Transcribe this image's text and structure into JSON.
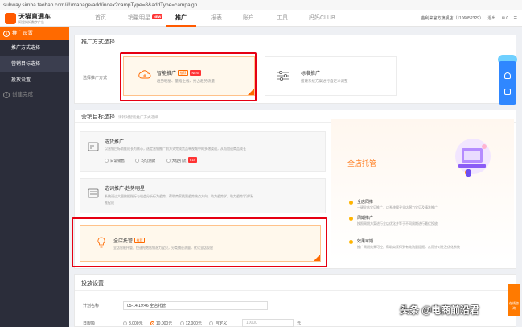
{
  "browser": {
    "url": "subway.simba.taobao.com/#!/manage/add/index?campType=8&addType=campaign"
  },
  "header": {
    "logo_title": "天猫直通车",
    "logo_sub": "阿里妈妈数字广告",
    "nav": [
      {
        "label": "首页"
      },
      {
        "label": "销量明星",
        "badge": "NEW"
      },
      {
        "label": "推广"
      },
      {
        "label": "报表"
      },
      {
        "label": "账户"
      },
      {
        "label": "工具"
      },
      {
        "label": "妈妈CLUB"
      }
    ],
    "shop": "金利来官方旗舰店（1106052329）",
    "logout": "退出",
    "msg_count": "0"
  },
  "sidebar": {
    "step1": {
      "num": "1",
      "label": "推广设置"
    },
    "items": [
      {
        "label": "推广方式选择"
      },
      {
        "label": "营销目标选择"
      },
      {
        "label": "投放设置"
      }
    ],
    "step2": {
      "num": "2",
      "label": "创建完成"
    }
  },
  "promo_method": {
    "title": "推广方式选择",
    "row_label": "选择推广方式",
    "smart": {
      "title": "智能推广",
      "tag": "推荐",
      "tag_new": "NEW",
      "desc": "趋势明星、量晗上线、抢占趋势流量"
    },
    "standard": {
      "title": "标准推广",
      "desc": "搭建系统方案进行自定义调整"
    }
  },
  "goal": {
    "title": "营销目标选择",
    "subtitle": "请针对智能推广方式选择",
    "opt1": {
      "title": "选货推广",
      "desc": "以营销目标助推成长为核心，选定营销推广前方式完成货品单视频中的多增渠道，从而加速商品成长",
      "radios": [
        {
          "label": "日常销售",
          "checked": false
        },
        {
          "label": "均匀测款",
          "checked": false
        },
        {
          "label": "大促引流",
          "checked": false,
          "badge": "618"
        }
      ]
    },
    "opt2": {
      "title": "选词推广-趋势明星",
      "desc1": "系统通过大量数据指标与机会分析行为趋势，帮助商家找到趋势热点方向，助力趋势学，助力趋势学流场",
      "desc2": "推促成"
    },
    "opt3": {
      "title": "全店托管",
      "tag": "推荐",
      "desc": "全店智能托管，快速抢跑店铺潜力宝贝，分类捕获流量，优化全店投放"
    }
  },
  "banner": {
    "title": "全店托管",
    "features": [
      {
        "title": "全店同推",
        "desc": "一键全店宝贝推广，以系统搜寻全店潜力宝贝及精准推广"
      },
      {
        "title": "周期推广",
        "desc": "按照周期方案进行全店优化并等于不同周期进行最优投放"
      },
      {
        "title": "效果可期",
        "desc": "推广周期效果可控，帮助商家得到有效流量提报，从而针对性及优化系统"
      }
    ]
  },
  "settings": {
    "title": "投放设置",
    "plan_name_label": "计划名称",
    "plan_name_value": "05-14 19:46 全店托管",
    "budget_label": "日限额",
    "budget_options": [
      {
        "label": "8,000元",
        "checked": false
      },
      {
        "label": "10,000元",
        "checked": true
      },
      {
        "label": "12,000元",
        "checked": false
      },
      {
        "label": "自定义",
        "checked": false
      }
    ],
    "custom_value": "10000",
    "unit": "元"
  },
  "help": {
    "label": "在线咨询"
  },
  "watermark": "头条 @电商前沿君",
  "colors": {
    "accent": "#ff6a00",
    "sidebar": "#2b2d3a",
    "highlight": "#e60012"
  }
}
